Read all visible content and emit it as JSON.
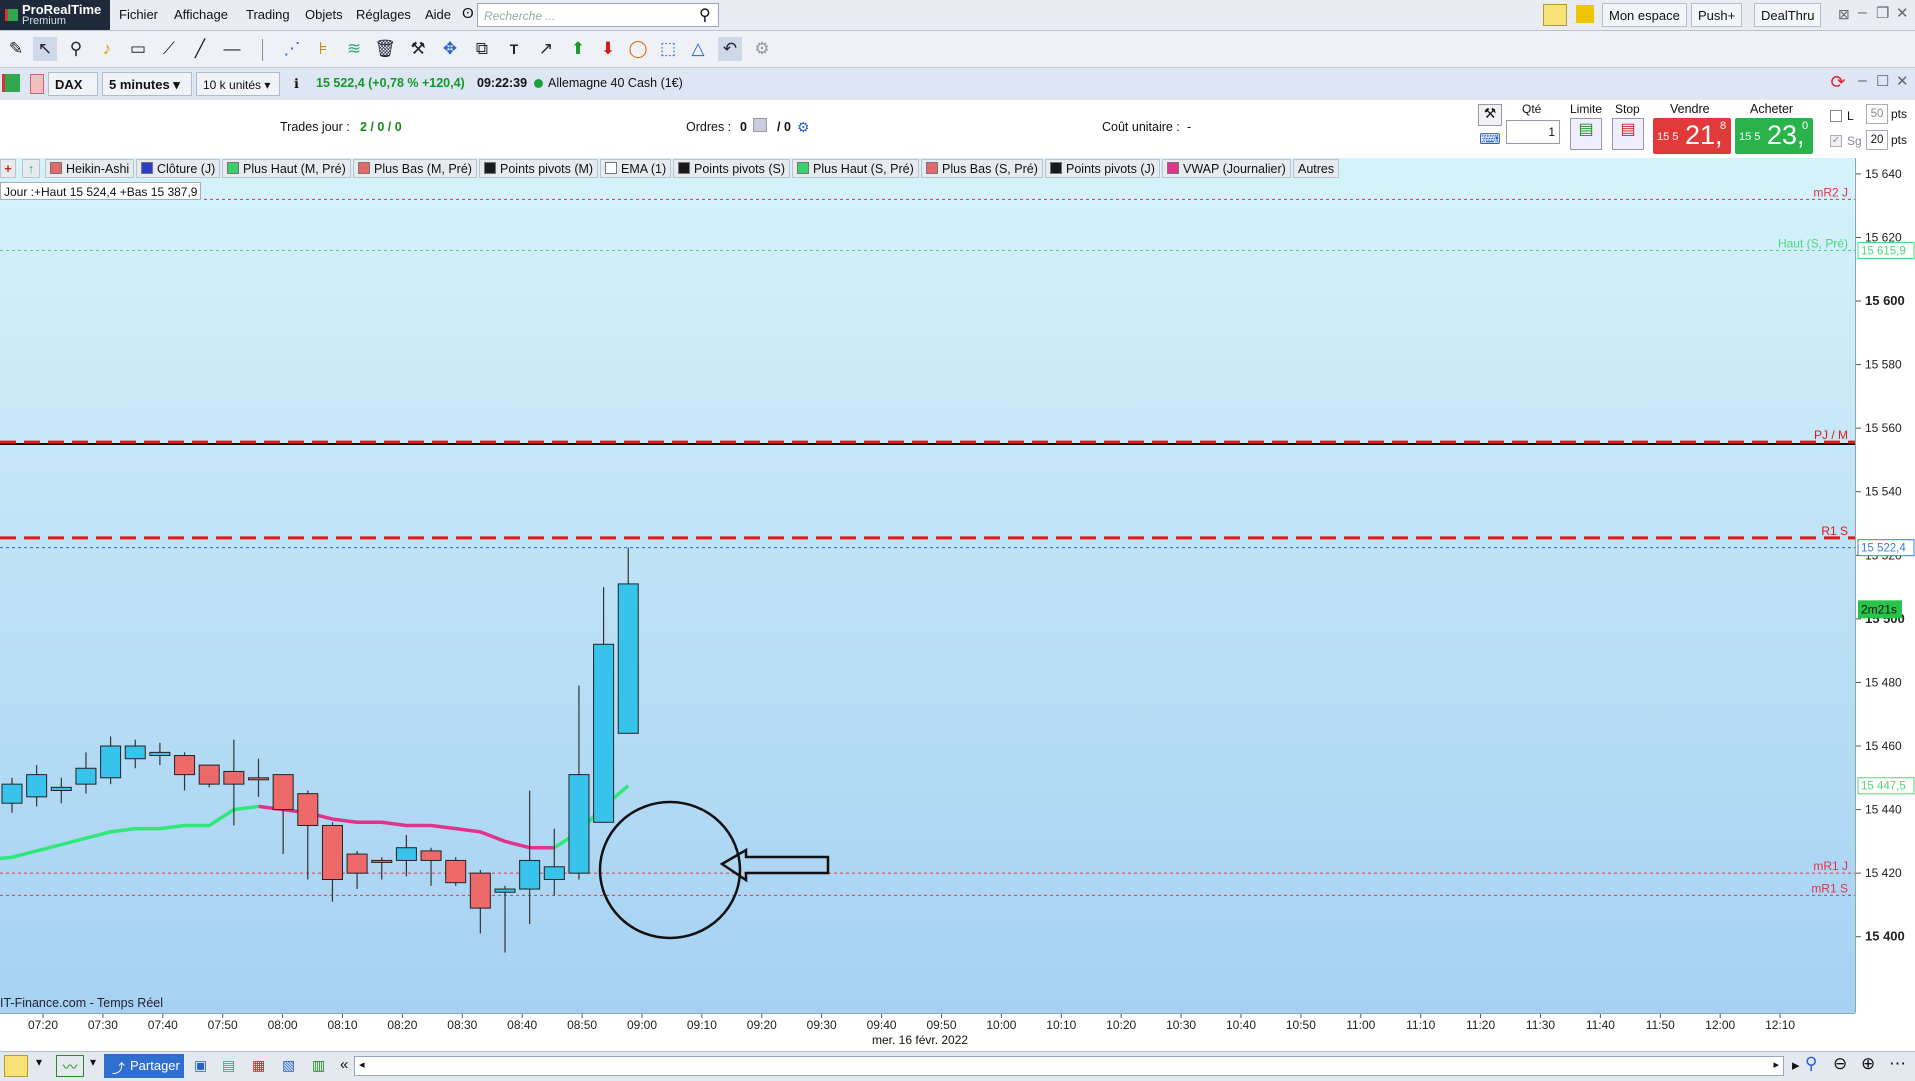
{
  "app": {
    "name_line1": "ProRealTime",
    "name_line2": "Premium"
  },
  "menu": [
    "Fichier",
    "Affichage",
    "Trading",
    "Objets",
    "Réglages",
    "Aide"
  ],
  "search": {
    "placeholder": "Recherche ..."
  },
  "header_right": {
    "mon_espace": "Mon espace",
    "push": "Push+",
    "dealthru": "DealThru"
  },
  "instrument": {
    "symbol": "DAX",
    "timeframe": "5 minutes",
    "units": "10 k unités",
    "price_change": "15 522,4 (+0,78 % +120,4)",
    "time": "09:22:39",
    "name": "Allemagne 40 Cash (1€)"
  },
  "trade": {
    "trades_label": "Trades jour :",
    "trades_value": "2 / 0 / 0",
    "orders_label": "Ordres :",
    "orders_a": "0",
    "orders_b": "/ 0",
    "cost_label": "Coût unitaire :",
    "cost_value": "-",
    "qty_label": "Qté",
    "qty_value": "1",
    "limit_label": "Limite",
    "stop_label": "Stop",
    "sell_label": "Vendre",
    "sell_prefix": "15 5",
    "sell_big": "21,",
    "sell_small": "8",
    "buy_label": "Acheter",
    "buy_prefix": "15 5",
    "buy_big": "23,",
    "buy_small": "0",
    "l_label": "L",
    "sg_label": "Sg",
    "pts1": "50",
    "pts2": "20",
    "pts_unit": "pts"
  },
  "tabs": [
    {
      "label": "Heikin-Ashi",
      "color": "#e06a6a"
    },
    {
      "label": "Clôture (J)",
      "color": "#2d3fc8"
    },
    {
      "label": "Plus Haut (M, Pré)",
      "color": "#3ad06a"
    },
    {
      "label": "Plus Bas (M, Pré)",
      "color": "#e06a6a"
    },
    {
      "label": "Points pivots (M)",
      "color": "#1a1a1a"
    },
    {
      "label": "EMA (1)",
      "color": "#ffffff"
    },
    {
      "label": "Points pivots (S)",
      "color": "#1a1a1a"
    },
    {
      "label": "Plus Haut (S, Pré)",
      "color": "#3ad06a"
    },
    {
      "label": "Plus Bas (S, Pré)",
      "color": "#e06a6a"
    },
    {
      "label": "Points pivots (J)",
      "color": "#1a1a1a"
    },
    {
      "label": "VWAP (Journalier)",
      "color": "#e0338c"
    },
    {
      "label": "Autres",
      "color": ""
    }
  ],
  "chart_info": "Jour :+Haut 15 524,4 +Bas 15 387,9",
  "source": "IT-Finance.com - Temps Réel",
  "date_label": "mer. 16 févr. 2022",
  "countdown": "2m21s",
  "chart_data": {
    "type": "candlestick",
    "ylim": [
      15376,
      15645
    ],
    "y_ticks": [
      15640,
      15620,
      15600,
      15580,
      15560,
      15540,
      15520,
      15500,
      15480,
      15460,
      15440,
      15420,
      15400
    ],
    "y_tick_labels": [
      "15 640",
      "15 620",
      "15 600",
      "15 580",
      "15 560",
      "15 540",
      "15 520",
      "15 500",
      "15 480",
      "15 460",
      "15 440",
      "15 420",
      "15 400"
    ],
    "y_bold": [
      15600,
      15500,
      15400
    ],
    "x_ticks": [
      "07:20",
      "07:30",
      "07:40",
      "07:50",
      "08:00",
      "08:10",
      "08:20",
      "08:30",
      "08:40",
      "08:50",
      "09:00",
      "09:10",
      "09:20",
      "09:30",
      "09:40",
      "09:50",
      "10:00",
      "10:10",
      "10:20",
      "10:30",
      "10:40",
      "10:50",
      "11:00",
      "11:10",
      "11:20",
      "11:30",
      "11:40",
      "11:50",
      "12:00",
      "12:10"
    ],
    "candles": [
      {
        "o": 15442,
        "h": 15450,
        "l": 15439,
        "c": 15448,
        "up": true
      },
      {
        "o": 15444,
        "h": 15454,
        "l": 15441,
        "c": 15451,
        "up": true
      },
      {
        "o": 15446,
        "h": 15450,
        "l": 15442,
        "c": 15447,
        "up": true
      },
      {
        "o": 15448,
        "h": 15458,
        "l": 15445,
        "c": 15453,
        "up": true
      },
      {
        "o": 15450,
        "h": 15463,
        "l": 15448,
        "c": 15460,
        "up": true
      },
      {
        "o": 15456,
        "h": 15462,
        "l": 15453,
        "c": 15460,
        "up": true
      },
      {
        "o": 15458,
        "h": 15461,
        "l": 15454,
        "c": 15457,
        "up": true
      },
      {
        "o": 15457,
        "h": 15458,
        "l": 15446,
        "c": 15451,
        "up": false
      },
      {
        "o": 15454,
        "h": 15454,
        "l": 15447,
        "c": 15448,
        "up": false
      },
      {
        "o": 15452,
        "h": 15462,
        "l": 15435,
        "c": 15448,
        "up": false
      },
      {
        "o": 15450,
        "h": 15456,
        "l": 15444,
        "c": 15450,
        "up": false
      },
      {
        "o": 15451,
        "h": 15451,
        "l": 15426,
        "c": 15440,
        "up": false
      },
      {
        "o": 15445,
        "h": 15446,
        "l": 15418,
        "c": 15435,
        "up": false
      },
      {
        "o": 15435,
        "h": 15436,
        "l": 15411,
        "c": 15418,
        "up": false
      },
      {
        "o": 15426,
        "h": 15427,
        "l": 15415,
        "c": 15420,
        "up": false
      },
      {
        "o": 15424,
        "h": 15425,
        "l": 15418,
        "c": 15424,
        "up": false
      },
      {
        "o": 15424,
        "h": 15432,
        "l": 15419,
        "c": 15428,
        "up": true
      },
      {
        "o": 15427,
        "h": 15428,
        "l": 15416,
        "c": 15424,
        "up": false
      },
      {
        "o": 15424,
        "h": 15425,
        "l": 15416,
        "c": 15417,
        "up": false
      },
      {
        "o": 15420,
        "h": 15421,
        "l": 15401,
        "c": 15409,
        "up": false
      },
      {
        "o": 15414,
        "h": 15416,
        "l": 15395,
        "c": 15415,
        "up": true
      },
      {
        "o": 15415,
        "h": 15446,
        "l": 15404,
        "c": 15424,
        "up": true
      },
      {
        "o": 15418,
        "h": 15434,
        "l": 15413,
        "c": 15422,
        "up": true
      },
      {
        "o": 15420,
        "h": 15479,
        "l": 15418,
        "c": 15451,
        "up": true
      },
      {
        "o": 15436,
        "h": 15510,
        "l": 15436,
        "c": 15492,
        "up": true
      },
      {
        "o": 15464,
        "h": 15522.4,
        "l": 15464,
        "c": 15511,
        "up": true
      }
    ],
    "ema": [
      {
        "i": -1.2,
        "v": 15424
      },
      {
        "i": 0,
        "v": 15425
      },
      {
        "i": 1,
        "v": 15427
      },
      {
        "i": 2,
        "v": 15429
      },
      {
        "i": 3,
        "v": 15431
      },
      {
        "i": 4,
        "v": 15433
      },
      {
        "i": 5,
        "v": 15434
      },
      {
        "i": 6,
        "v": 15434
      },
      {
        "i": 7,
        "v": 15435
      },
      {
        "i": 8,
        "v": 15435
      },
      {
        "i": 9,
        "v": 15440
      },
      {
        "i": 10,
        "v": 15441
      },
      {
        "i": 11,
        "v": 15440
      },
      {
        "i": 12,
        "v": 15439
      },
      {
        "i": 13,
        "v": 15437
      },
      {
        "i": 14,
        "v": 15436
      },
      {
        "i": 15,
        "v": 15436
      },
      {
        "i": 16,
        "v": 15435
      },
      {
        "i": 17,
        "v": 15435
      },
      {
        "i": 18,
        "v": 15434
      },
      {
        "i": 19,
        "v": 15433
      },
      {
        "i": 20,
        "v": 15430
      },
      {
        "i": 21,
        "v": 15428
      },
      {
        "i": 22,
        "v": 15428
      },
      {
        "i": 23,
        "v": 15433
      },
      {
        "i": 24,
        "v": 15441
      },
      {
        "i": 25,
        "v": 15447.5
      }
    ],
    "hlines": [
      {
        "v": 15632,
        "color": "#e0334a",
        "style": "dotted",
        "label": "mR2 J"
      },
      {
        "v": 15615.9,
        "color": "#4ed877",
        "style": "dotted",
        "label": "Haut (S, Pré)"
      },
      {
        "v": 15555,
        "color": "#111111",
        "style": "solid",
        "label": ""
      },
      {
        "v": 15555.6,
        "color": "#e01a1a",
        "style": "dashed-bold",
        "label": "PJ / M"
      },
      {
        "v": 15525.5,
        "color": "#e01a1a",
        "style": "dashed-bold",
        "label": "R1 S"
      },
      {
        "v": 15522.4,
        "color": "#3366cc",
        "style": "dotted",
        "label": ""
      },
      {
        "v": 15420,
        "color": "#e0334a",
        "style": "dotted",
        "label": "mR1 J"
      },
      {
        "v": 15413,
        "color": "#e0334a",
        "style": "dotted",
        "label": "mR1 S"
      }
    ],
    "price_tags": [
      {
        "v": 15615.9,
        "label": "15 615,9",
        "color": "#4ed877"
      },
      {
        "v": 15522.4,
        "label": "15 522,4",
        "color": "#3a7de0"
      },
      {
        "v": 15447.5,
        "label": "15 447,5",
        "color": "#4ed877"
      }
    ]
  }
}
